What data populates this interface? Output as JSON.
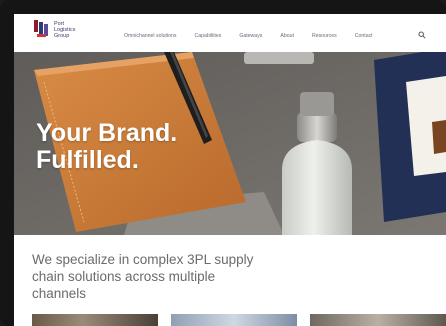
{
  "logo": {
    "name_line1": "Port",
    "name_line2": "Logistics",
    "name_line3": "Group",
    "colors": [
      "#8a1c2b",
      "#2c3a7a",
      "#5b4a9a",
      "#c63a3a"
    ]
  },
  "nav": {
    "items": [
      "Omnichannel solutions",
      "Capabilities",
      "Gateways",
      "About",
      "Resources",
      "Contact"
    ],
    "search_icon": "search-icon"
  },
  "hero": {
    "line1": "Your Brand.",
    "line2": "Fulfilled."
  },
  "intro": {
    "line1": "We specialize in complex 3PL supply",
    "line2": "chain solutions across multiple",
    "line3": "channels"
  },
  "colors": {
    "text_nav": "#6a6a7a",
    "intro_text": "#6b6b6b",
    "hero_text": "#ffffff"
  }
}
